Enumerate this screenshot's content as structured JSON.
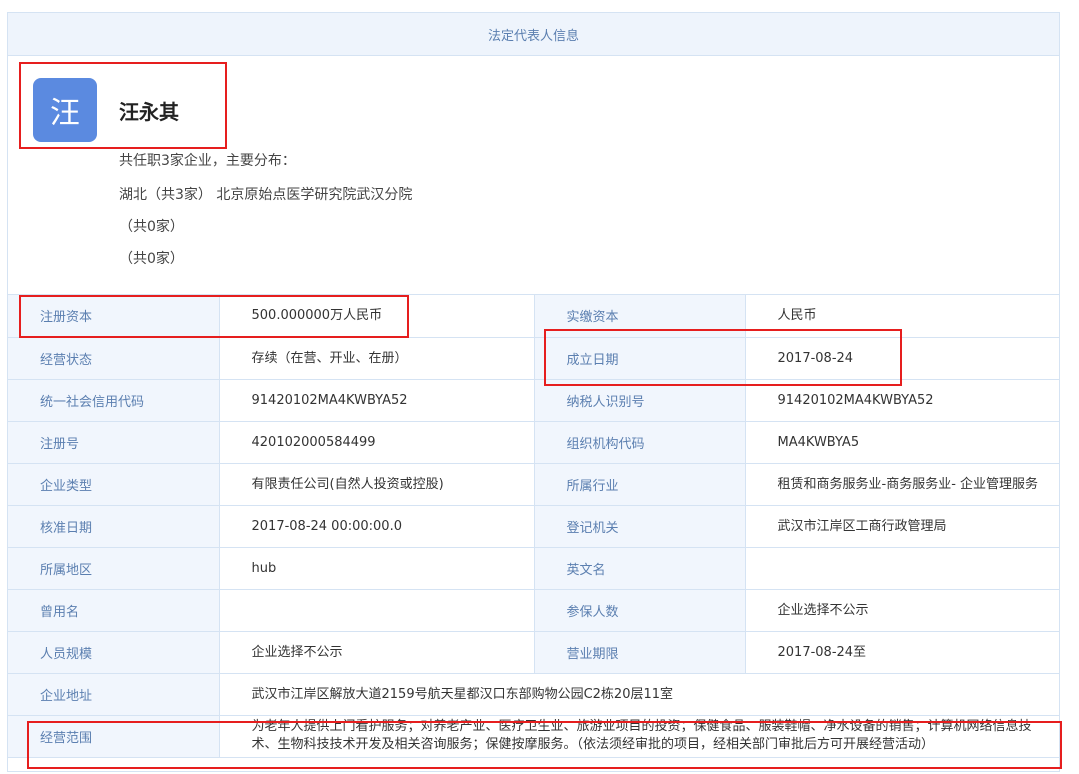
{
  "panel": {
    "title": "法定代表人信息"
  },
  "profile": {
    "avatar_char": "汪",
    "name": "汪永其",
    "summary": "共任职3家企业，主要分布：",
    "regions": [
      "湖北（共3家） 北京原始点医学研究院武汉分院",
      "（共0家）",
      "（共0家）"
    ]
  },
  "rows": [
    [
      {
        "label": "注册资本",
        "value": "500.000000万人民币"
      },
      {
        "label": "实缴资本",
        "value": "人民币"
      }
    ],
    [
      {
        "label": "经营状态",
        "value": "存续（在营、开业、在册）"
      },
      {
        "label": "成立日期",
        "value": "2017-08-24"
      }
    ],
    [
      {
        "label": "统一社会信用代码",
        "value": "91420102MA4KWBYA52"
      },
      {
        "label": "纳税人识别号",
        "value": "91420102MA4KWBYA52"
      }
    ],
    [
      {
        "label": "注册号",
        "value": "420102000584499"
      },
      {
        "label": "组织机构代码",
        "value": "MA4KWBYA5"
      }
    ],
    [
      {
        "label": "企业类型",
        "value": "有限责任公司(自然人投资或控股)"
      },
      {
        "label": "所属行业",
        "value": "租赁和商务服务业-商务服务业- 企业管理服务"
      }
    ],
    [
      {
        "label": "核准日期",
        "value": "2017-08-24 00:00:00.0"
      },
      {
        "label": "登记机关",
        "value": "武汉市江岸区工商行政管理局"
      }
    ],
    [
      {
        "label": "所属地区",
        "value": "hub"
      },
      {
        "label": "英文名",
        "value": ""
      }
    ],
    [
      {
        "label": "曾用名",
        "value": ""
      },
      {
        "label": "参保人数",
        "value": "企业选择不公示"
      }
    ],
    [
      {
        "label": "人员规模",
        "value": "企业选择不公示"
      },
      {
        "label": "营业期限",
        "value": "2017-08-24至"
      }
    ]
  ],
  "address": {
    "label": "企业地址",
    "value": "武汉市江岸区解放大道2159号航天星都汉口东部购物公园C2栋20层11室"
  },
  "scope": {
    "label": "经营范围",
    "value": "为老年人提供上门看护服务；对养老产业、医疗卫生业、旅游业项目的投资；保健食品、服装鞋帽、净水设备的销售；计算机网络信息技术、生物科技技术开发及相关咨询服务；保健按摩服务。（依法须经审批的项目，经相关部门审批后方可开展经营活动）"
  }
}
